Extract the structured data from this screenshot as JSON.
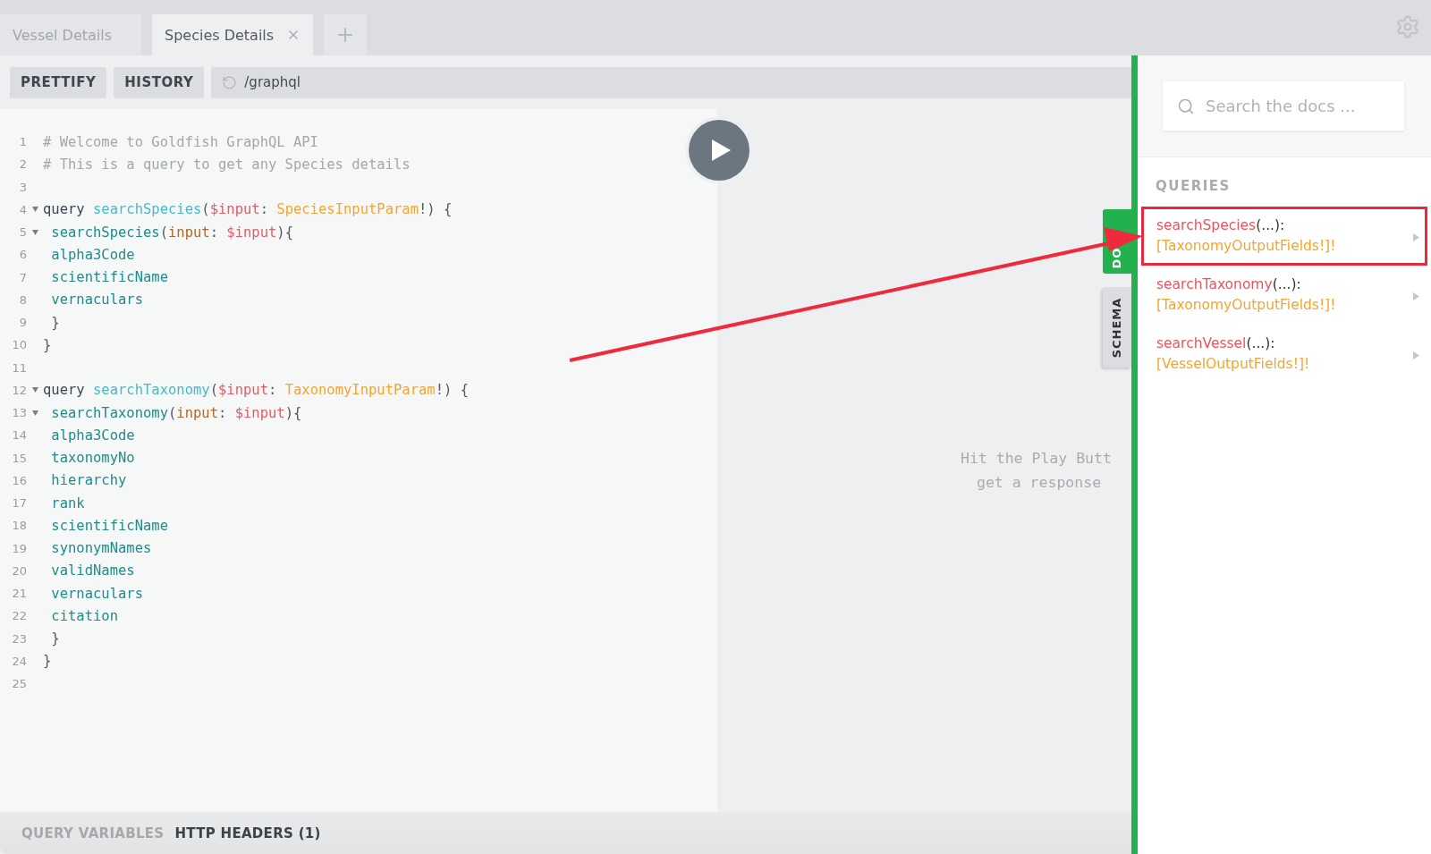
{
  "tabs": [
    {
      "label": "Vessel Details",
      "selected": false,
      "closable": false
    },
    {
      "label": "Species Details",
      "selected": true,
      "closable": true
    }
  ],
  "toolbar": {
    "buttons": [
      "PRETTIFY",
      "HISTORY"
    ],
    "url": "/graphql"
  },
  "editor": {
    "lines": [
      {
        "number": "1",
        "foldable": false,
        "tokens": [
          {
            "kind": "comment",
            "text": "# Welcome to Goldfish GraphQL API"
          }
        ]
      },
      {
        "number": "2",
        "foldable": false,
        "tokens": [
          {
            "kind": "comment",
            "text": "# This is a query to get any Species details"
          }
        ]
      },
      {
        "number": "3",
        "foldable": false
      },
      {
        "number": "4",
        "foldable": true,
        "tokens": [
          {
            "kind": "keyword",
            "text": "query "
          },
          {
            "kind": "def",
            "text": "searchSpecies"
          },
          {
            "kind": "punct",
            "text": "("
          },
          {
            "kind": "variable",
            "text": "$input"
          },
          {
            "kind": "punct",
            "text": ": "
          },
          {
            "kind": "type",
            "text": "SpeciesInputParam"
          },
          {
            "kind": "punct",
            "text": "!) {"
          }
        ]
      },
      {
        "number": "5",
        "foldable": true,
        "tokens": [
          {
            "kind": "property",
            "text": " searchSpecies"
          },
          {
            "kind": "punct",
            "text": "("
          },
          {
            "kind": "attribute",
            "text": "input"
          },
          {
            "kind": "punct",
            "text": ": "
          },
          {
            "kind": "variable",
            "text": "$input"
          },
          {
            "kind": "punct",
            "text": "){"
          }
        ]
      },
      {
        "number": "6",
        "foldable": false,
        "tokens": [
          {
            "kind": "property",
            "text": " alpha3Code"
          }
        ]
      },
      {
        "number": "7",
        "foldable": false,
        "tokens": [
          {
            "kind": "property",
            "text": " scientificName"
          }
        ]
      },
      {
        "number": "8",
        "foldable": false,
        "tokens": [
          {
            "kind": "property",
            "text": " vernaculars"
          }
        ]
      },
      {
        "number": "9",
        "foldable": false,
        "tokens": [
          {
            "kind": "punct",
            "text": " }"
          }
        ]
      },
      {
        "number": "10",
        "foldable": false,
        "tokens": [
          {
            "kind": "punct",
            "text": "}"
          }
        ]
      },
      {
        "number": "11",
        "foldable": false
      },
      {
        "number": "12",
        "foldable": true,
        "tokens": [
          {
            "kind": "keyword",
            "text": "query "
          },
          {
            "kind": "def",
            "text": "searchTaxonomy"
          },
          {
            "kind": "punct",
            "text": "("
          },
          {
            "kind": "variable",
            "text": "$input"
          },
          {
            "kind": "punct",
            "text": ": "
          },
          {
            "kind": "type",
            "text": "TaxonomyInputParam"
          },
          {
            "kind": "punct",
            "text": "!) {"
          }
        ]
      },
      {
        "number": "13",
        "foldable": true,
        "tokens": [
          {
            "kind": "property",
            "text": " searchTaxonomy"
          },
          {
            "kind": "punct",
            "text": "("
          },
          {
            "kind": "attribute",
            "text": "input"
          },
          {
            "kind": "punct",
            "text": ": "
          },
          {
            "kind": "variable",
            "text": "$input"
          },
          {
            "kind": "punct",
            "text": "){"
          }
        ]
      },
      {
        "number": "14",
        "foldable": false,
        "tokens": [
          {
            "kind": "property",
            "text": " alpha3Code"
          }
        ]
      },
      {
        "number": "15",
        "foldable": false,
        "tokens": [
          {
            "kind": "property",
            "text": " taxonomyNo"
          }
        ]
      },
      {
        "number": "16",
        "foldable": false,
        "tokens": [
          {
            "kind": "property",
            "text": " hierarchy"
          }
        ]
      },
      {
        "number": "17",
        "foldable": false,
        "tokens": [
          {
            "kind": "property",
            "text": " rank"
          }
        ]
      },
      {
        "number": "18",
        "foldable": false,
        "tokens": [
          {
            "kind": "property",
            "text": " scientificName"
          }
        ]
      },
      {
        "number": "19",
        "foldable": false,
        "tokens": [
          {
            "kind": "property",
            "text": " synonymNames"
          }
        ]
      },
      {
        "number": "20",
        "foldable": false,
        "tokens": [
          {
            "kind": "property",
            "text": " validNames"
          }
        ]
      },
      {
        "number": "21",
        "foldable": false,
        "tokens": [
          {
            "kind": "property",
            "text": " vernaculars"
          }
        ]
      },
      {
        "number": "22",
        "foldable": false,
        "tokens": [
          {
            "kind": "property",
            "text": " citation"
          }
        ]
      },
      {
        "number": "23",
        "foldable": false,
        "tokens": [
          {
            "kind": "punct",
            "text": " }"
          }
        ]
      },
      {
        "number": "24",
        "foldable": false,
        "tokens": [
          {
            "kind": "punct",
            "text": "}"
          }
        ]
      },
      {
        "number": "25",
        "foldable": false
      }
    ]
  },
  "result": {
    "message": [
      "Hit the Play Butt",
      "get a response"
    ]
  },
  "side_tabs": [
    {
      "label": "DO",
      "selected": true
    },
    {
      "label": "SCHEMA",
      "selected": false
    }
  ],
  "docs": {
    "search_placeholder": "Search the docs ...",
    "heading": "QUERIES",
    "queries": [
      {
        "name": "searchSpecies",
        "args": "(...):",
        "type": "[TaxonomyOutputFields!]!",
        "highlighted": true
      },
      {
        "name": "searchTaxonomy",
        "args": "(...):",
        "type": "[TaxonomyOutputFields!]!",
        "highlighted": false
      },
      {
        "name": "searchVessel",
        "args": "(...):",
        "type": "[VesselOutputFields!]!",
        "highlighted": false
      }
    ]
  },
  "bottom_tabs": [
    {
      "label": "QUERY VARIABLES",
      "selected": false
    },
    {
      "label": "HTTP HEADERS (1)",
      "selected": true
    }
  ]
}
